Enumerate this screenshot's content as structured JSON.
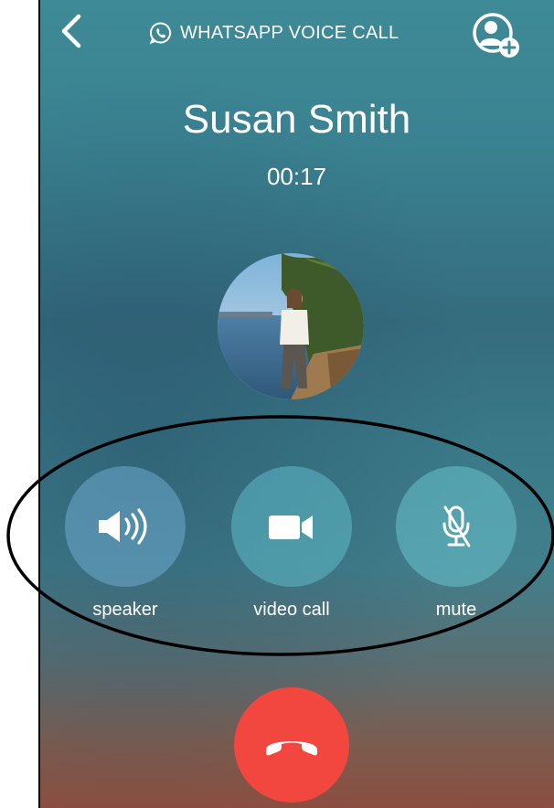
{
  "header": {
    "title": "WHATSAPP VOICE CALL",
    "back_icon": "chevron-left-icon",
    "title_icon": "whatsapp-phone-icon",
    "add_icon": "add-participant-icon"
  },
  "call": {
    "contact_name": "Susan Smith",
    "duration": "00:17"
  },
  "controls": {
    "speaker_label": "speaker",
    "video_label": "video call",
    "mute_label": "mute"
  },
  "colors": {
    "end_call": "#f1473e",
    "text": "#ffffff",
    "annotation_outline": "#000000"
  }
}
